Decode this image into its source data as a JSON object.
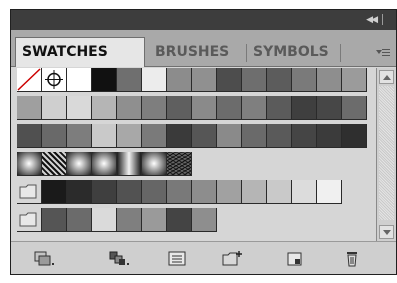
{
  "panel": {
    "collapse_glyph": "◀◀",
    "tabs": [
      {
        "label": "SWATCHES",
        "active": true
      },
      {
        "label": "BRUSHES",
        "active": false
      },
      {
        "label": "SYMBOLS",
        "active": false
      }
    ]
  },
  "icons": {
    "collapse": "double-chevron-left-icon",
    "menu": "panel-menu-icon",
    "swatch_libraries": "swatch-libraries-menu-icon",
    "show_kinds": "show-swatch-kinds-icon",
    "swatch_options": "swatch-options-icon",
    "new_group": "new-color-group-icon",
    "new_swatch": "new-swatch-icon",
    "delete": "delete-swatch-icon"
  },
  "swatch_rows": [
    [
      "none",
      "registration",
      "#ffffff",
      "#111111",
      "#6f6f6f",
      "#ececec",
      "#8c8c8c",
      "#909090",
      "#4d4d4d",
      "#6e6e6e",
      "#5c5c5c",
      "#7a7a7a",
      "#8e8e8e",
      "#9b9b9b"
    ],
    [
      "#9f9f9f",
      "#cfcfcf",
      "#d9d9d9",
      "#b5b5b5",
      "#8f8f8f",
      "#7e7e7e",
      "#5f5f5f",
      "#8a8a8a",
      "#6c6c6c",
      "#7f7f7f",
      "#5b5b5b",
      "#3f3f3f",
      "#474747",
      "#6c6c6c"
    ],
    [
      "#505050",
      "#696969",
      "#7d7d7d",
      "#c9c9c9",
      "#a8a8a8",
      "#7a7a7a",
      "#3a3a3a",
      "#565656",
      "#8a8a8a",
      "#6a6a6a",
      "#5a5a5a",
      "#454545",
      "#3b3b3b",
      "#2f2f2f"
    ],
    [
      "grad-radial-dark",
      "pattern-dots",
      "grad-radial-dark",
      "grad-radial-dark",
      "grad-linear",
      "grad-radial-dark",
      "pattern-noise"
    ],
    [
      "group",
      "#1a1a1a",
      "#2b2b2b",
      "#3f3f3f",
      "#525252",
      "#666666",
      "#797979",
      "#8d8d8d",
      "#a1a1a1",
      "#b5b5b5",
      "#c9c9c9",
      "#dcdcdc",
      "#f0f0f0"
    ],
    [
      "group",
      "#555555",
      "#6b6b6b",
      "#dadada",
      "#7f7f7f",
      "#9a9a9a",
      "#444444",
      "#8e8e8e"
    ]
  ]
}
